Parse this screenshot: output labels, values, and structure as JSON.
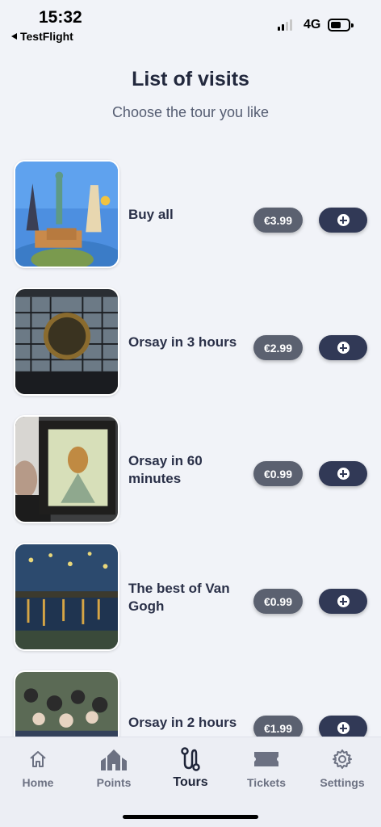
{
  "status_bar": {
    "time": "15:32",
    "back_app": "TestFlight",
    "network": "4G"
  },
  "header": {
    "title": "List of visits",
    "subtitle": "Choose the tour you like"
  },
  "tours": [
    {
      "title": "Buy all",
      "price": "€3.99",
      "image": "world-landmarks"
    },
    {
      "title": "Orsay in 3 hours",
      "price": "€2.99",
      "image": "orsay-clock"
    },
    {
      "title": "Orsay in 60 minutes",
      "price": "€0.99",
      "image": "van-gogh-portrait"
    },
    {
      "title": "The best of Van Gogh",
      "price": "€0.99",
      "image": "starry-night-rhone"
    },
    {
      "title": "Orsay in 2 hours",
      "price": "€1.99",
      "image": "moulin-galette"
    }
  ],
  "tabbar": {
    "items": [
      {
        "label": "Home",
        "icon": "home-icon"
      },
      {
        "label": "Points",
        "icon": "points-icon"
      },
      {
        "label": "Tours",
        "icon": "tours-icon"
      },
      {
        "label": "Tickets",
        "icon": "ticket-icon"
      },
      {
        "label": "Settings",
        "icon": "gear-icon"
      }
    ],
    "active": "Tours"
  },
  "colors": {
    "background": "#f1f3f8",
    "price_pill": "#5b6170",
    "add_button": "#313956",
    "text": "#2a3048"
  }
}
